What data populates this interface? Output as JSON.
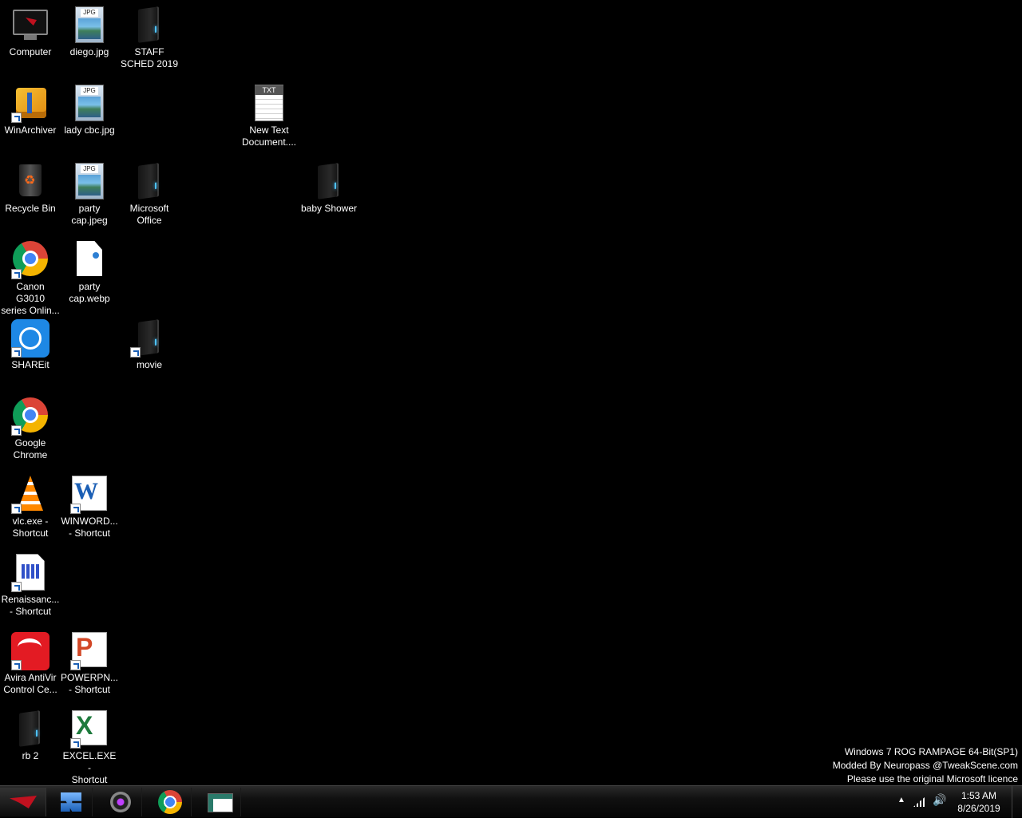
{
  "desktop": {
    "icons": [
      {
        "label": "Computer",
        "icon": "computer-icon"
      },
      {
        "label": "WinArchiver",
        "icon": "archiver-icon"
      },
      {
        "label": "Recycle Bin",
        "icon": "recycle-bin-icon"
      },
      {
        "label": "Canon G3010\nseries Onlin...",
        "icon": "chrome-shortcut-icon"
      },
      {
        "label": "SHAREit",
        "icon": "shareit-icon"
      },
      {
        "label": "Google\nChrome",
        "icon": "chrome-icon"
      },
      {
        "label": "vlc.exe -\nShortcut",
        "icon": "vlc-icon"
      },
      {
        "label": "Renaissanc...\n- Shortcut",
        "icon": "renaissance-icon"
      },
      {
        "label": "Avira AntiVir\nControl Ce...",
        "icon": "avira-icon"
      },
      {
        "label": "rb 2",
        "icon": "folder-icon"
      },
      {
        "label": "diego.jpg",
        "icon": "jpg-file-icon"
      },
      {
        "label": "lady cbc.jpg",
        "icon": "jpg-file-icon"
      },
      {
        "label": "party\ncap.jpeg",
        "icon": "jpg-file-icon"
      },
      {
        "label": "party\ncap.webp",
        "icon": "blank-file-icon"
      },
      {
        "label": "WINWORD...\n- Shortcut",
        "icon": "word-icon"
      },
      {
        "label": "POWERPN...\n- Shortcut",
        "icon": "powerpoint-icon"
      },
      {
        "label": "EXCEL.EXE -\nShortcut",
        "icon": "excel-icon"
      },
      {
        "label": "STAFF\nSCHED 2019",
        "icon": "folder-icon"
      },
      {
        "label": "Microsoft\nOffice",
        "icon": "folder-icon"
      },
      {
        "label": "movie",
        "icon": "folder-shortcut-icon"
      },
      {
        "label": "New Text\nDocument....",
        "icon": "txt-file-icon"
      },
      {
        "label": "baby Shower",
        "icon": "folder-icon"
      }
    ],
    "file_tags": {
      "jpg": "JPG",
      "txt": "TXT"
    }
  },
  "watermark": {
    "line1": "Windows 7 ROG RAMPAGE 64-Bit(SP1)",
    "line2": "Modded By Neuropass @TweakScene.com",
    "line3": "Please use the original Microsoft licence"
  },
  "taskbar": {
    "pinned": [
      "windows-explorer-icon",
      "camera-app-icon",
      "chrome-icon",
      "app-window-icon"
    ],
    "tray": {
      "expand": "▲",
      "volume": "🔊"
    },
    "clock": {
      "time": "1:53 AM",
      "date": "8/26/2019"
    }
  },
  "colors": {
    "rog_red": "#c0111f",
    "desktop_bg": "#000000"
  }
}
